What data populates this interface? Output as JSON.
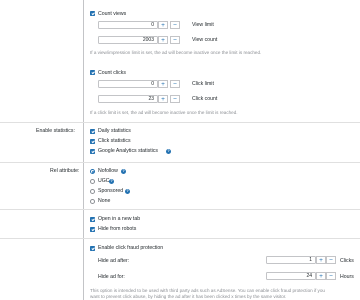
{
  "count_views": {
    "checkbox_label": "Count views",
    "view_limit": {
      "value": "0",
      "label": "View limit"
    },
    "view_count": {
      "value": "2003",
      "label": "View count"
    },
    "hint": "If a view/impression limit is set, the ad will become inactive once the limit is reached."
  },
  "count_clicks": {
    "checkbox_label": "Count clicks",
    "click_limit": {
      "value": "0",
      "label": "Click limit"
    },
    "click_count": {
      "value": "23",
      "label": "Click count"
    },
    "hint": "If a click limit is set, the ad will become inactive once the limit is reached."
  },
  "statistics": {
    "label": "Enable statistics:",
    "options": [
      "Daily statistics",
      "Click statistics",
      "Google Analytics statistics"
    ]
  },
  "rel": {
    "label": "Rel attribute:",
    "options": [
      "Nofollow",
      "UGC",
      "Sponsored",
      "None"
    ],
    "selected": "Nofollow"
  },
  "link_options": [
    "Open in a new tab",
    "Hide from robots"
  ],
  "fraud": {
    "checkbox_label": "Enable click fraud protection",
    "hide_after": {
      "label": "Hide ad after:",
      "value": "1",
      "unit": "Clicks"
    },
    "hide_for": {
      "label": "Hide ad for:",
      "value": "24",
      "unit": "Hours"
    },
    "hint_line1": "This option is intended to be used with third party ads such as AdSense. You can enable click fraud protection if you",
    "hint_line2": "want to prevent click abuse, by hiding the ad after it has been clicked x times by the same visitor."
  },
  "stepper": {
    "plus": "+",
    "minus": "−"
  },
  "colors": {
    "accent": "#2271b1",
    "hint": "#8c8f94",
    "border": "#c3c4c7"
  }
}
